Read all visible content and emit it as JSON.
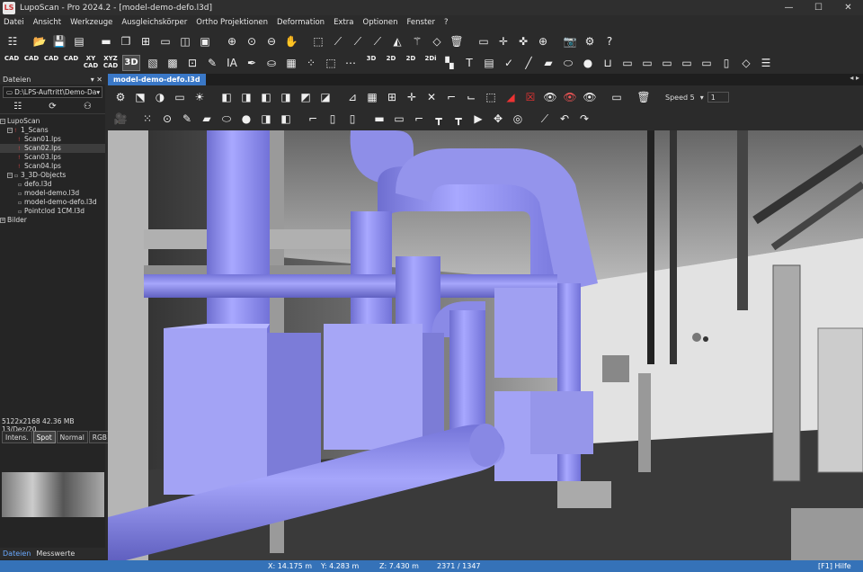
{
  "window": {
    "app_badge": "LS",
    "title": "LupoScan - Pro 2024.2 - [model-demo-defo.l3d]"
  },
  "menu": [
    "Datei",
    "Ansicht",
    "Werkzeuge",
    "Ausgleichskörper",
    "Ortho Projektionen",
    "Deformation",
    "Extra",
    "Optionen",
    "Fenster",
    "?"
  ],
  "toolbar2_labels": {
    "cad1": "CAD",
    "cad2": "CAD",
    "cad3": "CAD",
    "cad4": "CAD",
    "xy_cad": "XY\nCAD",
    "xyz_cad": "XYZ\nCAD",
    "view3d": "3D",
    "ia": "IA",
    "a3d": "3D",
    "a2d": "2D",
    "b2d": "2D",
    "b2di": "2Di",
    "text_t": "T"
  },
  "left_panel": {
    "header": "Dateien",
    "path": "D:\\LPS-Auftritt\\Demo-Da",
    "tree": [
      {
        "label": "LupoScan",
        "level": 0
      },
      {
        "label": "1_Scans",
        "level": 1
      },
      {
        "label": "Scan01.lps",
        "level": 2
      },
      {
        "label": "Scan02.lps",
        "level": 2,
        "selected": true
      },
      {
        "label": "Scan03.lps",
        "level": 2
      },
      {
        "label": "Scan04.lps",
        "level": 2
      },
      {
        "label": "3_3D-Objects",
        "level": 1
      },
      {
        "label": "defo.l3d",
        "level": 2
      },
      {
        "label": "model-demo.l3d",
        "level": 2
      },
      {
        "label": "model-demo-defo.l3d",
        "level": 2
      },
      {
        "label": "Pointclod 1CM.l3d",
        "level": 2
      },
      {
        "label": "Bilder",
        "level": 0
      }
    ],
    "file_info": "5122x2168  42.36 MB  13/Dez/20",
    "modes": [
      "Intens.",
      "Spot",
      "Normal",
      "RGB"
    ],
    "active_mode": "Spot",
    "bottom_tabs": [
      "Dateien",
      "Messwerte"
    ]
  },
  "document_tab": "model-demo-defo.l3d",
  "view_toolbar": {
    "speed_label": "Speed 5",
    "speed_value": "1"
  },
  "statusbar": {
    "x": "X: 14.175 m",
    "y": "Y: 4.283 m",
    "z": "Z: 7.430 m",
    "px": "2371 / 1347",
    "help": "[F1] Hilfe"
  },
  "colors": {
    "pipe": "#9a9af0",
    "status": "#3572b8",
    "tab": "#3a78c7"
  }
}
